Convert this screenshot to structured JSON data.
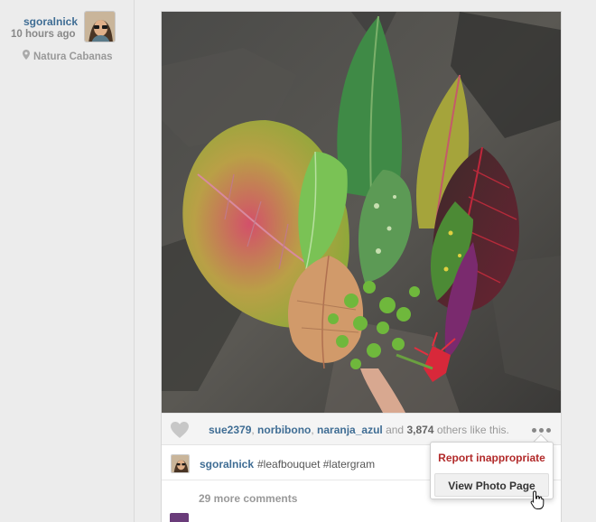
{
  "post": {
    "username": "sgoralnick",
    "time_ago": "10 hours ago",
    "location": "Natura Cabanas"
  },
  "likes": {
    "users": [
      "sue2379",
      "norbibono",
      "naranja_azul"
    ],
    "sep1": ", ",
    "sep2": ", ",
    "and_text": " and ",
    "count": "3,874",
    "suffix": " others like this."
  },
  "caption": {
    "username": "sgoralnick",
    "text": "#leafbouquet #latergram"
  },
  "comments": {
    "more_label": "29 more comments"
  },
  "menu": {
    "report_label": "Report inappropriate",
    "view_label": "View Photo Page"
  },
  "icons": {
    "heart": "heart-icon",
    "location": "location-pin-icon",
    "more": "more-dots-icon",
    "cursor": "hand-cursor-icon"
  },
  "colors": {
    "link": "#3f6d94",
    "report": "#b22a2a",
    "background": "#ededed"
  }
}
